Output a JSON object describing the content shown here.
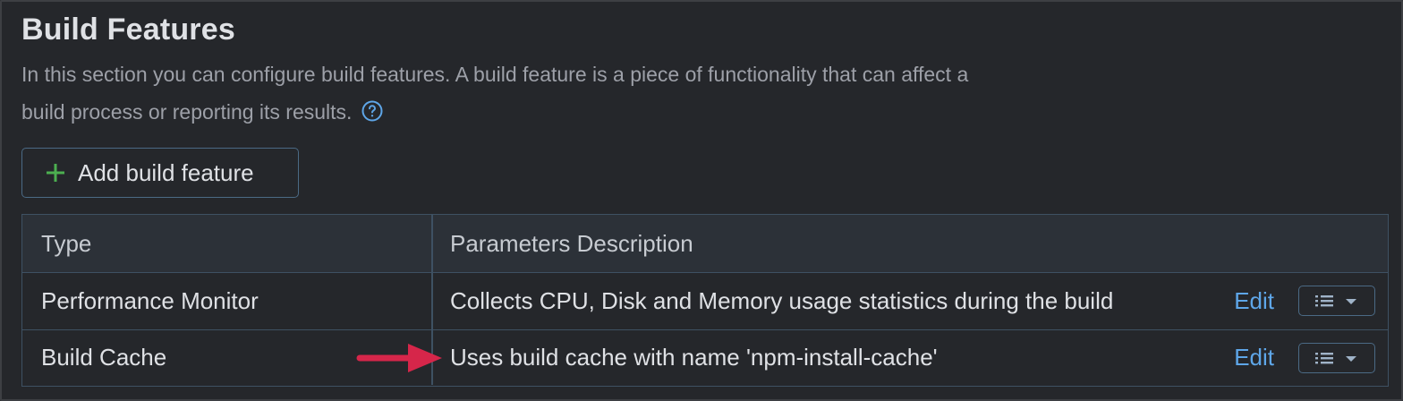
{
  "section": {
    "title": "Build Features",
    "description_line1": "In this section you can configure build features. A build feature is a piece of functionality that can affect a",
    "description_line2": "build process or reporting its results.",
    "help_icon": "question-circle-icon"
  },
  "add_button": {
    "icon": "plus-icon",
    "label": "Add build feature"
  },
  "table": {
    "headers": [
      "Type",
      "Parameters Description"
    ],
    "rows": [
      {
        "type": "Performance Monitor",
        "params": "Collects CPU, Disk and Memory usage statistics during the build",
        "edit_label": "Edit",
        "menu_icon": "list-dropdown-icon"
      },
      {
        "type": "Build Cache",
        "params": "Uses build cache with name 'npm-install-cache'",
        "edit_label": "Edit",
        "menu_icon": "list-dropdown-icon"
      }
    ]
  },
  "colors": {
    "background": "#25272b",
    "accent_link": "#5ea6e8",
    "plus_green": "#4caf50",
    "annotation_arrow": "#d6264a"
  }
}
